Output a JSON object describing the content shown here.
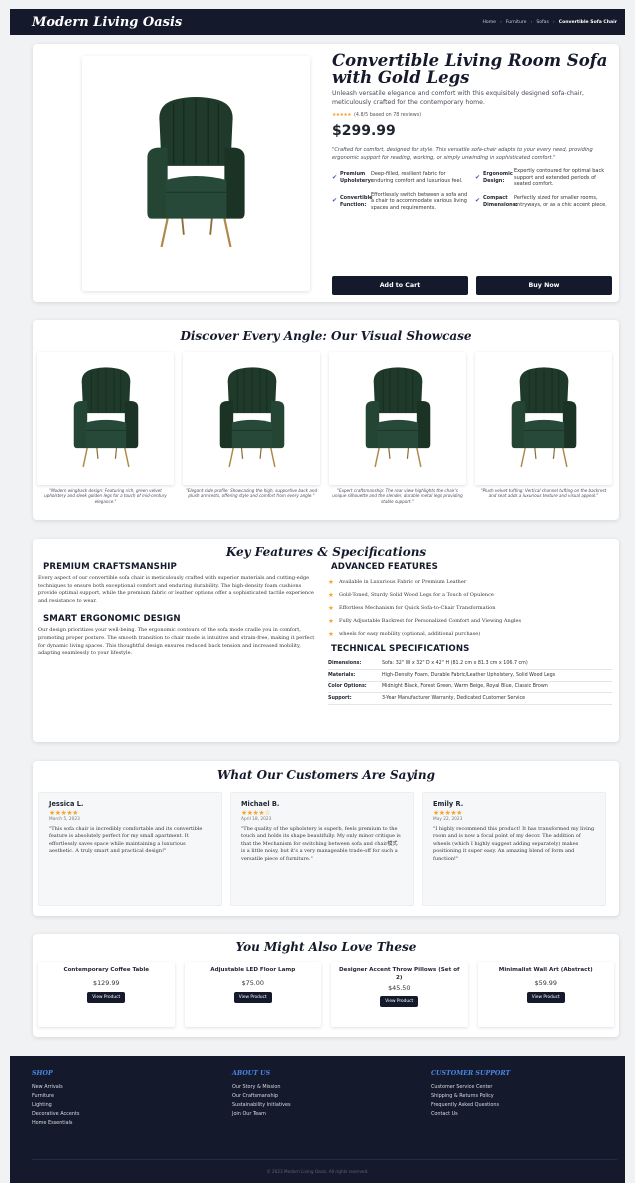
{
  "header": {
    "brand": "Modern Living Oasis",
    "breadcrumbs": [
      "Home",
      "Furniture",
      "Sofas",
      "Convertible Sofa Chair"
    ],
    "separator": "›"
  },
  "product": {
    "title": "Convertible Living Room Sofa with Gold Legs",
    "subtitle": "Unleash versatile elegance and comfort with this exquisitely designed sofa-chair, meticulously crafted for the contemporary home.",
    "stars": "★★★★★",
    "rating_text": "(4.8/5 based on 78 reviews)",
    "price": "$299.99",
    "quote": "\"Crafted for comfort, designed for style. This versatile sofa-chair adapts to your every need, providing ergonomic support for reading, working, or simply unwinding in sophisticated comfort.\"",
    "features": [
      {
        "label": "Premium Upholstery:",
        "desc": "Deep-filled, resilient fabric for enduring comfort and luxurious feel."
      },
      {
        "label": "Ergonomic Design:",
        "desc": "Expertly contoured for optimal back support and extended periods of seated comfort."
      },
      {
        "label": "Convertible Function:",
        "desc": "Effortlessly switch between a sofa and a chair to accommodate various living spaces and requirements."
      },
      {
        "label": "Compact Dimensions:",
        "desc": "Perfectly sized for smaller rooms, entryways, or as a chic accent piece."
      }
    ],
    "add_to_cart": "Add to Cart",
    "buy_now": "Buy Now"
  },
  "gallery": {
    "title": "Discover Every Angle: Our Visual Showcase",
    "items": [
      {
        "caption": "\"Modern wingback design: Featuring rich, green velvet upholstery and sleek golden legs for a touch of mid-century elegance.\""
      },
      {
        "caption": "\"Elegant side profile: Showcasing the high, supportive back and plush armrests, offering style and comfort from every angle.\""
      },
      {
        "caption": "\"Expert craftsmanship: The rear view highlights the chair's unique silhouette and the slender, durable metal legs providing stable support.\""
      },
      {
        "caption": "\"Plush velvet tufting: Vertical channel tufting on the backrest and seat adds a luxurious texture and visual appeal.\""
      }
    ]
  },
  "features": {
    "title": "Key Features & Specifications",
    "craft_heading": "PREMIUM CRAFTSMANSHIP",
    "craft_text": "Every aspect of our convertible sofa chair is meticulously crafted with superior materials and cutting-edge techniques to ensure both exceptional comfort and enduring durability. The high-density foam cushions provide optimal support, while the premium fabric or leather options offer a sophisticated tactile experience and resistance to wear.",
    "ergo_heading": "SMART ERGONOMIC DESIGN",
    "ergo_text": "Our design prioritizes your well-being. The ergonomic contours of the sofa mode cradle you in comfort, promoting proper posture. The smooth transition to chair mode is intuitive and strain-free, making it perfect for dynamic living spaces. This thoughtful design ensures reduced back tension and increased mobility, adapting seamlessly to your lifestyle.",
    "adv_heading": "ADVANCED FEATURES",
    "adv_items": [
      "Available in Luxurious Fabric or Premium Leather",
      "Gold-Toned, Sturdy Solid Wood Legs for a Touch of Opulence",
      "Effortless Mechanism for Quick Sofa-to-Chair Transformation",
      "Fully Adjustable Backrest for Personalized Comfort and Viewing Angles",
      "wheels for easy mobility (optional, additional purchase)"
    ],
    "tech_heading": "TECHNICAL SPECIFICATIONS",
    "specs": [
      {
        "k": "Dimensions:",
        "v": "Sofa: 32\" W x 32\" D x 42\" H (81.2 cm x 81.3 cm x 106.7 cm)"
      },
      {
        "k": "Materials:",
        "v": "High-Density Foam, Durable Fabric/Leather Upholstery, Solid Wood Legs"
      },
      {
        "k": "Color Options:",
        "v": "Midnight Black, Forest Green, Warm Beige, Royal Blue, Classic Brown"
      },
      {
        "k": "Support:",
        "v": "3-Year Manufacturer Warranty, Dedicated Customer Service"
      }
    ]
  },
  "reviews": {
    "title": "What Our Customers Are Saying",
    "items": [
      {
        "name": "Jessica L.",
        "stars": "★★★★★",
        "date": "March 5, 2023",
        "text": "\"This sofa chair is incredibly comfortable and its convertible feature is absolutely perfect for my small apartment. It effortlessly saves space while maintaining a luxurious aesthetic. A truly smart and practical design!\""
      },
      {
        "name": "Michael B.",
        "stars": "★★★★☆",
        "date": "April 18, 2023",
        "text": "\"The quality of the upholstery is superb, feels premium to the touch and holds its shape beautifully. My only minor critique is that the Mechanism for switching between sofa and chair模式 is a little noisy, but it's a very manageable trade-off for such a versatile piece of furniture.\""
      },
      {
        "name": "Emily R.",
        "stars": "★★★★★",
        "date": "May 22, 2023",
        "text": "\"I highly recommend this product! It has transformed my living room and is now a focal point of my decor. The addition of wheels (which I highly suggest adding separately) makes positioning it super easy. An amazing blend of form and function!\""
      }
    ]
  },
  "recommendations": {
    "title": "You Might Also Love These",
    "button_label": "View Product",
    "items": [
      {
        "name": "Contemporary Coffee Table",
        "price": "$129.99"
      },
      {
        "name": "Adjustable LED Floor Lamp",
        "price": "$75.00"
      },
      {
        "name": "Designer Accent Throw Pillows (Set of 2)",
        "price": "$45.50"
      },
      {
        "name": "Minimalist Wall Art (Abstract)",
        "price": "$59.99"
      }
    ]
  },
  "footer": {
    "shop_heading": "SHOP",
    "shop_links": [
      "New Arrivals",
      "Furniture",
      "Lighting",
      "Decorative Accents",
      "Home Essentials"
    ],
    "about_heading": "ABOUT US",
    "about_links": [
      "Our Story & Mission",
      "Our Craftsmanship",
      "Sustainability Initiatives",
      "Join Our Team"
    ],
    "support_heading": "CUSTOMER SUPPORT",
    "support_links": [
      "Customer Service Center",
      "Shipping & Returns Policy",
      "Frequently Asked Questions",
      "Contact Us"
    ],
    "copyright": "© 2023 Modern Living Oasis. All rights reserved."
  },
  "colors": {
    "navy": "#141a2b",
    "gold_star": "#f2a52e",
    "footer_heading": "#4a86e8",
    "chair_green": "#1f3a2b"
  },
  "icons": {
    "feature_check": "check-icon",
    "feature_bullet": "star-icon"
  }
}
